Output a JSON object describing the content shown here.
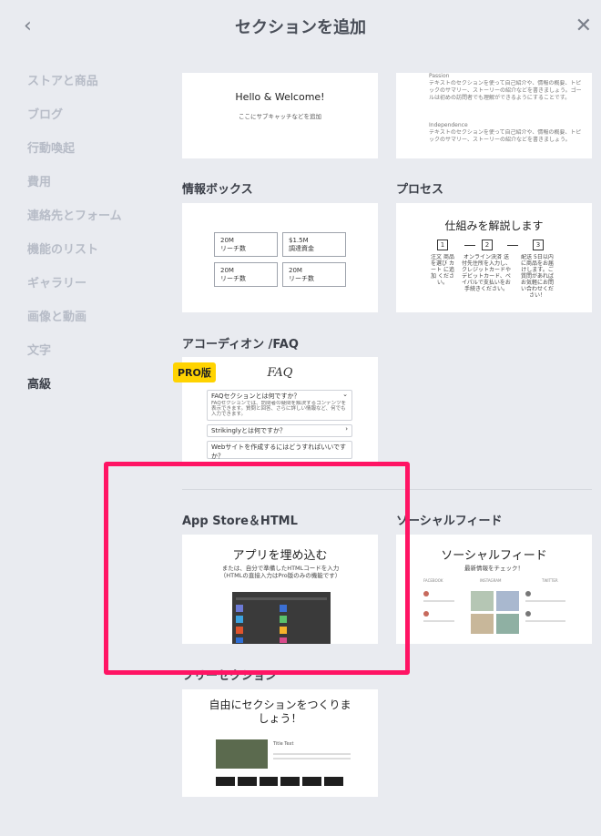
{
  "header": {
    "back_icon": "‹",
    "title": "セクションを追加",
    "close_icon": "✕"
  },
  "sidebar": {
    "items": [
      {
        "label": "ストアと商品"
      },
      {
        "label": "ブログ"
      },
      {
        "label": "行動喚起"
      },
      {
        "label": "費用"
      },
      {
        "label": "連絡先とフォーム"
      },
      {
        "label": "機能のリスト"
      },
      {
        "label": "ギャラリー"
      },
      {
        "label": "画像と動画"
      },
      {
        "label": "文字"
      },
      {
        "label": "高級",
        "active": true
      }
    ]
  },
  "cards": {
    "hello": {
      "heading": "Hello & Welcome!",
      "sub": "ここにサブキャッチなどを追加"
    },
    "text_preview": {
      "title1": "Passion",
      "body1": "テキストのセクションを使って自己紹介や、情報の概要、トピックのサマリー、ストーリーの紹介などを書きましょう。ゴールは初めの訪問者でも理解ができるようにすることです。",
      "title2": "Independence",
      "body2": "テキストのセクションを使って自己紹介や、情報の概要、トピックのサマリー、ストーリーの紹介などを書きましょう。"
    },
    "info_box": {
      "label": "情報ボックス",
      "boxes": [
        {
          "value": "20M",
          "caption": "リーチ数"
        },
        {
          "value": "$1.5M",
          "caption": "調達資金"
        },
        {
          "value": "20M",
          "caption": "リーチ数"
        },
        {
          "value": "20M",
          "caption": "リーチ数"
        }
      ]
    },
    "process": {
      "label": "プロセス",
      "heading": "仕組みを解説します",
      "steps": [
        {
          "num": "1",
          "text": "注文 商品を選び カート に追加 ください。"
        },
        {
          "num": "2",
          "text": "オンライン決済 送付先住所を入力し、クレジットカードやデビットカード、ペイパルで支払いをお手続きください。"
        },
        {
          "num": "3",
          "text": "配送 5日以内に商品をお届けします。ご質問があれば お気軽にお問い合わせください！"
        }
      ]
    },
    "accordion": {
      "label": "アコーディオン /FAQ",
      "pro_badge": "PRO版",
      "heading": "FAQ",
      "q1": "FAQセクションとは何ですか？",
      "a1": "FAQセクションでは、訪問者の疑問を解決するコンテンツを表示できます。質問と回答、さらに詳しい情報など、何でも入力できます。",
      "q2": "Strikinglyとは何ですか？",
      "q3": "Webサイトを作成するにはどうすればいいですか？"
    },
    "app_store": {
      "label": "App Store＆HTML",
      "heading": "アプリを埋め込む",
      "sub": "または、自分で準備したHTMLコードを入力（HTMLの直接入力はPro版のみの機能です）"
    },
    "social": {
      "label": "ソーシャルフィード",
      "heading": "ソーシャルフィード",
      "sub": "最新情報をチェック！",
      "col1": "FACEBOOK",
      "col2": "INSTAGRAM",
      "col3": "TWITTER"
    },
    "free": {
      "label": "フリーセクション",
      "heading": "自由にセクションをつくりましょう！",
      "title": "Title Text"
    }
  },
  "colors": {
    "highlight": "#ff1464",
    "pro": "#ffd300",
    "background": "#e9ebf0"
  }
}
